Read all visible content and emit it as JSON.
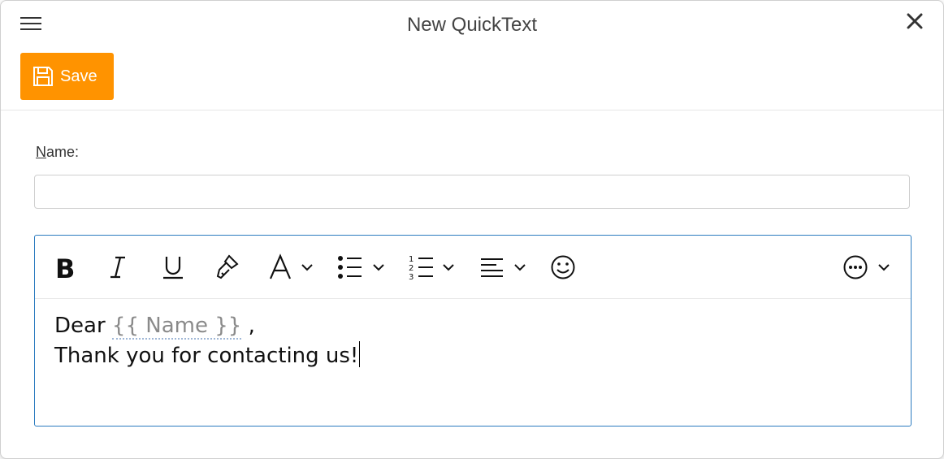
{
  "dialog": {
    "title": "New QuickText",
    "save_label": "Save"
  },
  "form": {
    "name_label_first": "N",
    "name_label_rest": "ame:",
    "name_value": ""
  },
  "editor": {
    "greeting": "Dear",
    "token": "{{ Name }}",
    "comma": " ,",
    "line2": "Thank you for contacting us!"
  },
  "colors": {
    "save_bg": "#ff9300",
    "editor_border": "#2b7bbf"
  },
  "icons": {
    "menu": "hamburger-icon",
    "close": "close-icon",
    "save": "floppy-disk-icon",
    "bold": "bold-icon",
    "italic": "italic-icon",
    "underline": "underline-icon",
    "format_painter": "format-painter-icon",
    "font": "font-icon",
    "bullets": "bulleted-list-icon",
    "numbering": "numbered-list-icon",
    "align": "align-left-icon",
    "emoji": "emoji-icon",
    "more": "more-options-icon"
  }
}
